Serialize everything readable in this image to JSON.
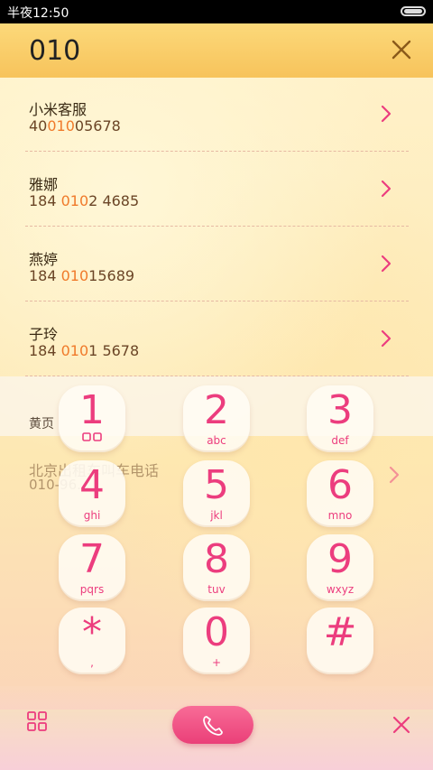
{
  "status_bar": {
    "time": "半夜12:50"
  },
  "search": {
    "query": "010"
  },
  "contacts": [
    {
      "name": "小米客服",
      "number_pre": "40",
      "number_hl": "010",
      "number_post": "05678"
    },
    {
      "name": "雅娜",
      "number_pre": "184 ",
      "number_hl": "010",
      "number_post": "2 4685"
    },
    {
      "name": "燕婷",
      "number_pre": "184 ",
      "number_hl": "010",
      "number_post": "15689"
    },
    {
      "name": "子玲",
      "number_pre": "184 ",
      "number_hl": "010",
      "number_post": "1 5678"
    }
  ],
  "yellow_pages": {
    "section_label": "黄页",
    "item_name": "北京出租车叫车电话",
    "item_number": "010-96..."
  },
  "keypad": [
    {
      "digit": "1",
      "letters": ""
    },
    {
      "digit": "2",
      "letters": "abc"
    },
    {
      "digit": "3",
      "letters": "def"
    },
    {
      "digit": "4",
      "letters": "ghi"
    },
    {
      "digit": "5",
      "letters": "jkl"
    },
    {
      "digit": "6",
      "letters": "mno"
    },
    {
      "digit": "7",
      "letters": "pqrs"
    },
    {
      "digit": "8",
      "letters": "tuv"
    },
    {
      "digit": "9",
      "letters": "wxyz"
    },
    {
      "digit": "*",
      "letters": ","
    },
    {
      "digit": "0",
      "letters": "+"
    },
    {
      "digit": "#",
      "letters": ""
    }
  ],
  "colors": {
    "accent": "#ec3d7e",
    "highlight": "#f07a2a",
    "header": "#f7c35b"
  },
  "icons": {
    "clear": "close-icon",
    "chevron": "chevron-right-icon",
    "grid": "grid-icon",
    "call": "phone-icon",
    "delete": "delete-icon",
    "voicemail": "voicemail-icon"
  }
}
